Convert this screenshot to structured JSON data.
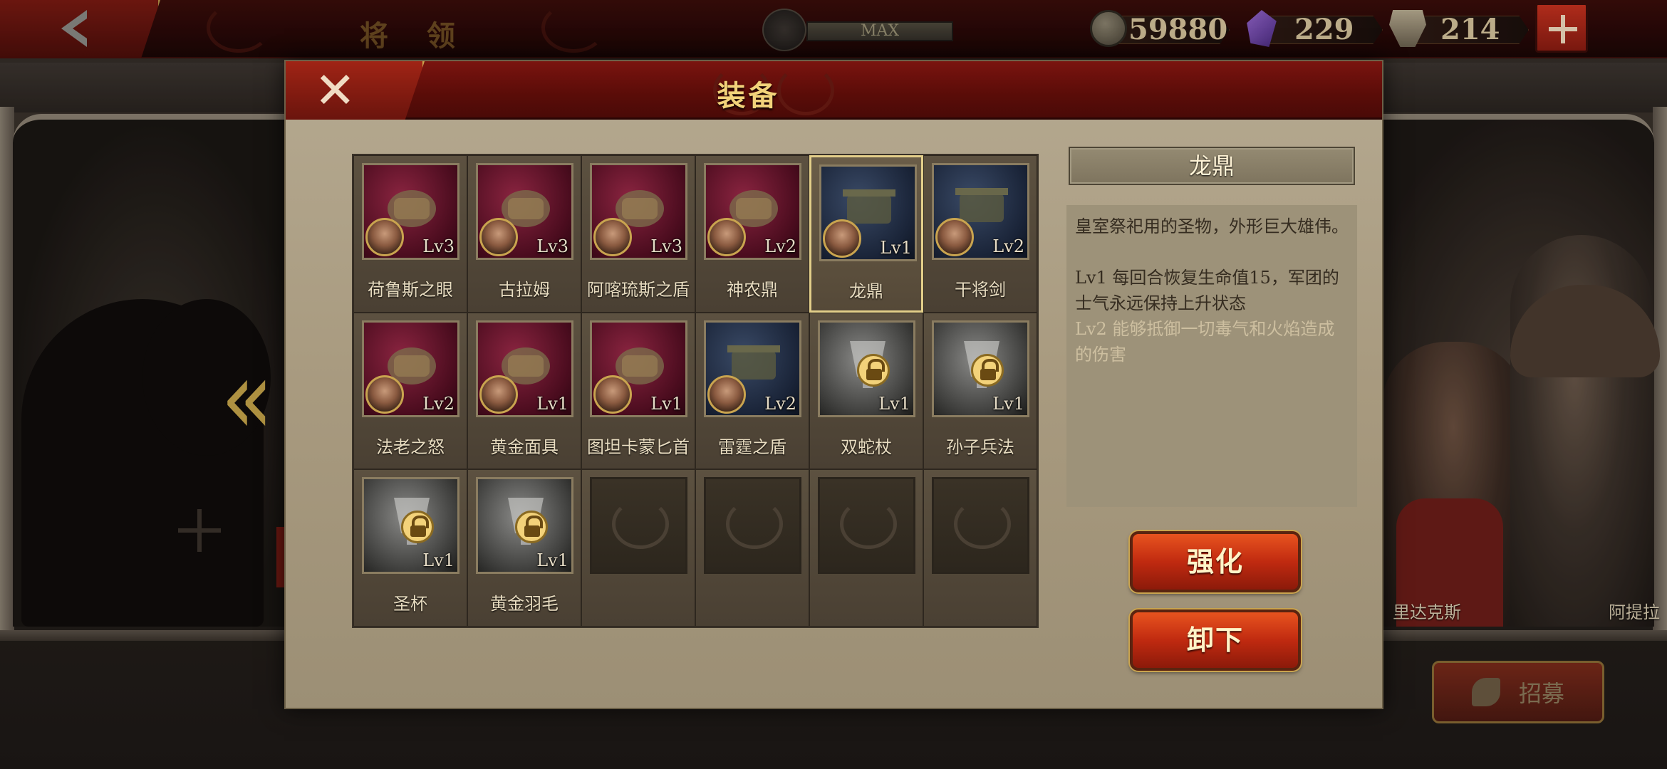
{
  "topbar": {
    "title": "将 领",
    "level_cap": "MAX",
    "currencies": [
      {
        "icon": "coin-icon",
        "value": "59880"
      },
      {
        "icon": "gem-icon",
        "value": "229"
      },
      {
        "icon": "crest-icon",
        "value": "214"
      }
    ]
  },
  "background": {
    "portrait_names": [
      "里达克斯",
      "阿提拉"
    ],
    "recruit_label": "招募"
  },
  "modal": {
    "title": "装备",
    "items": [
      {
        "name": "荷鲁斯之眼",
        "level": "Lv3",
        "bg": "red",
        "locked": false,
        "equipped": true
      },
      {
        "name": "古拉姆",
        "level": "Lv3",
        "bg": "red",
        "locked": false,
        "equipped": true
      },
      {
        "name": "阿喀琉斯之盾",
        "level": "Lv3",
        "bg": "red",
        "locked": false,
        "equipped": true
      },
      {
        "name": "神农鼎",
        "level": "Lv2",
        "bg": "red",
        "locked": false,
        "equipped": true
      },
      {
        "name": "龙鼎",
        "level": "Lv1",
        "bg": "blue",
        "locked": false,
        "equipped": true,
        "selected": true
      },
      {
        "name": "干将剑",
        "level": "Lv2",
        "bg": "blue",
        "locked": false,
        "equipped": true
      },
      {
        "name": "法老之怒",
        "level": "Lv2",
        "bg": "red",
        "locked": false,
        "equipped": true
      },
      {
        "name": "黄金面具",
        "level": "Lv1",
        "bg": "red",
        "locked": false,
        "equipped": true
      },
      {
        "name": "图坦卡蒙匕首",
        "level": "Lv1",
        "bg": "red",
        "locked": false,
        "equipped": true
      },
      {
        "name": "雷霆之盾",
        "level": "Lv2",
        "bg": "blue",
        "locked": false,
        "equipped": true
      },
      {
        "name": "双蛇杖",
        "level": "Lv1",
        "bg": "gray",
        "locked": true,
        "equipped": false
      },
      {
        "name": "孙子兵法",
        "level": "Lv1",
        "bg": "gray",
        "locked": true,
        "equipped": false
      },
      {
        "name": "圣杯",
        "level": "Lv1",
        "bg": "gray",
        "locked": true,
        "equipped": false
      },
      {
        "name": "黄金羽毛",
        "level": "Lv1",
        "bg": "gray",
        "locked": true,
        "equipped": false
      },
      {
        "name": "",
        "empty": true
      },
      {
        "name": "",
        "empty": true
      },
      {
        "name": "",
        "empty": true
      },
      {
        "name": "",
        "empty": true
      }
    ],
    "detail": {
      "title": "龙鼎",
      "description": "皇室祭祀用的圣物，外形巨大雄伟。",
      "effect_lv1": "Lv1 每回合恢复生命值15，军团的士气永远保持上升状态",
      "effect_lv2": "Lv2 能够抵御一切毒气和火焰造成的伤害"
    },
    "buttons": {
      "enhance": "强化",
      "unequip": "卸下"
    }
  },
  "colors": {
    "accent_gold": "#f2d27a",
    "header_red": "#7a140f",
    "button_orange": "#e8541f",
    "panel_tan": "#a89a7f"
  }
}
